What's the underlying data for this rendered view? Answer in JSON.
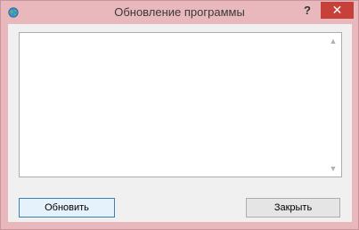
{
  "window": {
    "title": "Обновление программы",
    "help_label": "?",
    "close_glyph": "✕",
    "app_icon": "globe-icon"
  },
  "log": {
    "text": ""
  },
  "buttons": {
    "update_label": "Обновить",
    "close_label": "Закрыть"
  },
  "colors": {
    "frame": "#e8b8bd",
    "close_button": "#c7403a",
    "client_bg": "#f0f0f0",
    "default_button_border": "#3c7fb1"
  }
}
